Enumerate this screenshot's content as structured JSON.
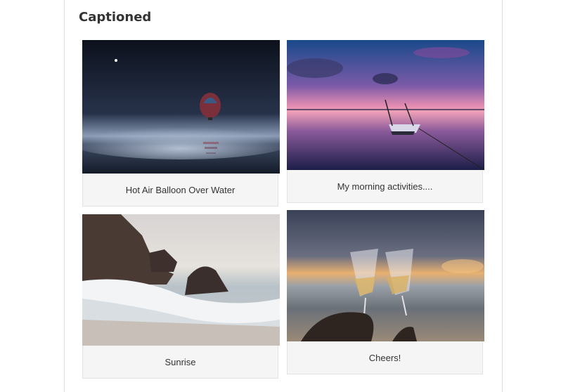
{
  "section": {
    "title": "Captioned"
  },
  "gallery": [
    {
      "caption": "Hot Air Balloon Over Water",
      "image": "hot-air-balloon-night-sea"
    },
    {
      "caption": "My morning activities....",
      "image": "boat-sunset-lake"
    },
    {
      "caption": "Sunrise",
      "image": "rocky-beach-waves"
    },
    {
      "caption": "Cheers!",
      "image": "champagne-toast-beach"
    }
  ],
  "colors": {
    "heading": "#333333",
    "caption_bg": "#f5f5f5",
    "caption_text": "#333333",
    "border": "#dddddd"
  }
}
